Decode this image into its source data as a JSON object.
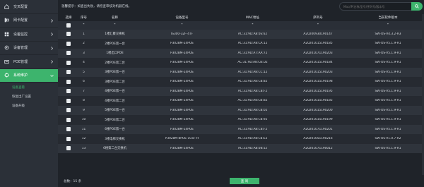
{
  "sidebar": {
    "items": [
      {
        "label": "交叉配置",
        "icon": "home-icon"
      },
      {
        "label": "网卡配置",
        "icon": "network-card-icon"
      },
      {
        "label": "设备监控",
        "icon": "monitor-icon"
      },
      {
        "label": "设备管理",
        "icon": "device-manage-icon"
      },
      {
        "label": "POE管理",
        "icon": "poe-icon"
      },
      {
        "label": "系统维护",
        "icon": "maintenance-icon"
      }
    ],
    "sub_items": [
      {
        "label": "设备查看"
      },
      {
        "label": "恢复出厂设置"
      },
      {
        "label": "设备升级"
      }
    ]
  },
  "topbar": {
    "tip": "温馨提示：如查出失败，请检查审核对机器在线。",
    "search_placeholder": "Mac/IP/名称/型号/序列号/版本号"
  },
  "table": {
    "headers": [
      "选择",
      "序号",
      "名称",
      "设备型号",
      "MAC地址",
      "序列号",
      "当前软件版本"
    ],
    "filter_row": [
      "*",
      "*",
      "*",
      "*",
      "*",
      "*"
    ],
    "rows": [
      [
        "1",
        "1楼汇聚交换机",
        "IS300-32F-4TF",
        "AC:31:9D:A8:0E:62",
        "A20200930190147",
        "SW-OS-V4.3.2-R3"
      ],
      [
        "2",
        "2楼POE第一台",
        "P3028M-24POE",
        "AC:31:9D:A8:CA:12",
        "A20201015190185",
        "SW-OS-V5.1.9-R1"
      ],
      [
        "3",
        "1楼出口POE",
        "P3028M-24POE",
        "AC:31:9D:A7:AA:72",
        "A20201071190203",
        "SW-OS-V5.1.9-R1"
      ],
      [
        "4",
        "2楼POE第二台",
        "P3028M-24POE",
        "AC:31:9D:A8:CB:D2",
        "A20201015190184",
        "SW-OS-V5.1.9-R1"
      ],
      [
        "5",
        "3楼POE第一台",
        "P3028M-24POE",
        "AC:31:9D:A8:CC:12",
        "A20201015190203",
        "SW-OS-V5.1.9-R1"
      ],
      [
        "6",
        "3楼POE第二台",
        "P3028M-24POE",
        "AC:31:9D:A8:CB:82",
        "A20201015190198",
        "SW-OS-V5.1.9-R1"
      ],
      [
        "7",
        "4楼POE第一台",
        "P3028M-24POE",
        "AC:31:9D:A8:CB:F2",
        "A20201015190195",
        "SW-OS-V5.1.9-R1"
      ],
      [
        "8",
        "4楼POE第二台",
        "P3028M-24POE",
        "AC:31:9D:A8:CB:B2",
        "A20201015190185",
        "SW-OS-V5.1.9-R1"
      ],
      [
        "9",
        "5楼POE第一台",
        "P3028M-24POE",
        "AC:31:9D:A8:CB:02",
        "A20201015190200",
        "SW-OS-V5.1.9-R1"
      ],
      [
        "10",
        "5楼POE第二台",
        "P3028M-24POE",
        "AC:31:9D:A8:CB:92",
        "A20201015190199",
        "SW-OS-V5.1.9-R1"
      ],
      [
        "11",
        "6楼POE第一台",
        "P3028M-24POE",
        "AC:31:9D:A8:CB:F2",
        "A20201071190201",
        "SW-OS-V5.1.9-R1"
      ],
      [
        "12",
        "3楼电梯交换机",
        "P3028M-8POE-1C6F-H",
        "AC:31:9D:A8:CB:E2",
        "A20201051190216",
        "SW-OS-V1.0.7-R2"
      ],
      [
        "13",
        "6楼第二台交换机",
        "P3028M-24POE",
        "AC:31:9D:A8:08:52",
        "A20201071190012",
        "SW-OS-V5.1.9-R1"
      ]
    ]
  },
  "footer": {
    "total": "总数：15 条",
    "query_label": "查 询"
  },
  "colors": {
    "accent": "#3db46d",
    "sidebar": "#2b3038",
    "background": "#1f2329"
  }
}
